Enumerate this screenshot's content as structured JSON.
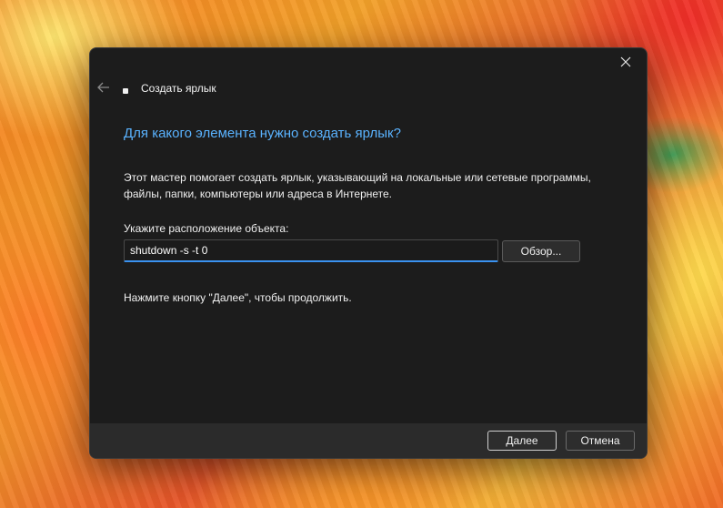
{
  "window": {
    "title": "Создать ярлык",
    "close_icon": "close-icon",
    "back_icon": "arrow-left-icon",
    "app_icon": "shortcut-icon"
  },
  "main": {
    "heading": "Для какого элемента нужно создать ярлык?",
    "description": "Этот мастер помогает создать ярлык, указывающий на локальные или сетевые программы, файлы, папки, компьютеры или адреса в Интернете.",
    "location_label": "Укажите расположение объекта:",
    "location_value": "shutdown -s -t 0",
    "browse_label": "Обзор...",
    "hint": "Нажмите кнопку \"Далее\", чтобы продолжить."
  },
  "footer": {
    "next_label": "Далее",
    "cancel_label": "Отмена"
  },
  "colors": {
    "accent": "#5ab3ff",
    "dialog_bg": "#1c1c1c",
    "footer_bg": "#2b2b2b",
    "input_focus": "#3a92f0"
  }
}
